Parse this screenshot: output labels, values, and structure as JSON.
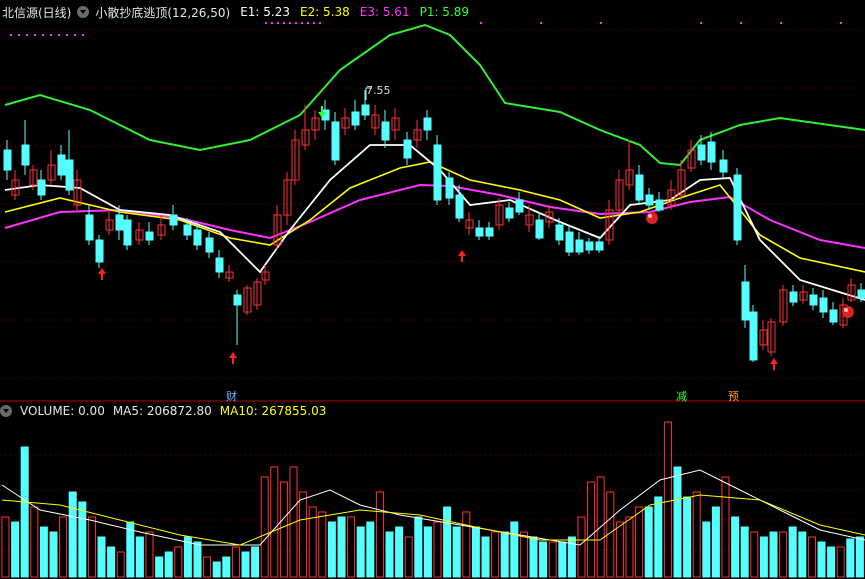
{
  "header": {
    "stock_name": "北信源(日线)",
    "indicator_name": "小散抄底逃顶(12,26,50)",
    "e1": "E1: 5.23",
    "e2": "E2: 5.38",
    "e3": "E3: 5.61",
    "p1": "P1: 5.89"
  },
  "price_panel": {
    "high_label": "7.55",
    "markers": [
      "财",
      "减",
      "预"
    ]
  },
  "volume_header": {
    "label": "VOLUME: 0.00",
    "ma5": "MA5: 206872.80",
    "ma10": "MA10: 267855.03"
  },
  "colors": {
    "up": "#ff3333",
    "down": "#54ffff",
    "white_line": "#ffffff",
    "yellow_line": "#ffff00",
    "magenta_line": "#ff33ff",
    "green_line": "#33ee33",
    "grid": "#8b0000"
  },
  "chart_data": [
    {
      "type": "line",
      "series": [
        {
          "name": "E1",
          "last": 5.23
        },
        {
          "name": "E2",
          "last": 5.38
        },
        {
          "name": "E3",
          "last": 5.61
        },
        {
          "name": "P1",
          "last": 5.89
        }
      ]
    },
    {
      "type": "bar",
      "series": [
        {
          "name": "MA5",
          "last": 206872.8
        },
        {
          "name": "MA10",
          "last": 267855.03
        }
      ]
    }
  ]
}
